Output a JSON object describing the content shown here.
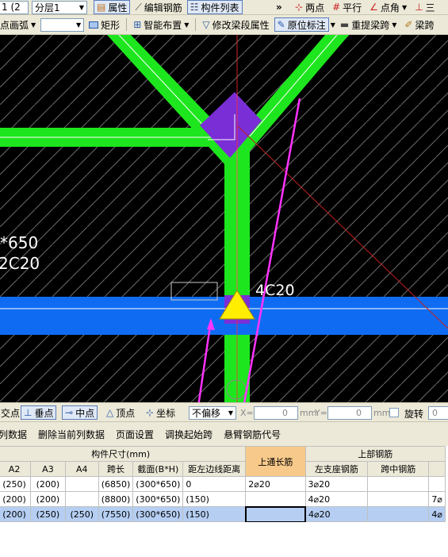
{
  "toolbar1": {
    "layer_select": "1 (2",
    "floor_select": "分层1",
    "btn_properties": "属性",
    "btn_edit_rebar": "编辑钢筋",
    "btn_component_list": "构件列表",
    "more": "»",
    "btn_two_points": "两点",
    "btn_parallel": "平行",
    "btn_point_angle": "点角",
    "btn_three": "三"
  },
  "toolbar2": {
    "btn_arc": "点画弧",
    "blank_select": "",
    "btn_rect": "矩形",
    "btn_smart_layout": "智能布置",
    "btn_modify_segment": "修改梁段属性",
    "btn_in_situ": "原位标注",
    "btn_repick_span": "重提梁跨",
    "btn_beam_span": "梁跨"
  },
  "canvas": {
    "label_section": "*650",
    "label_rebar_left": "2C20",
    "label_rebar": "4C20",
    "colors": {
      "beam_green": "#1ee61e",
      "beam_blue": "#0f6cf2",
      "column": "#7a2ed6",
      "support": "#ffee00",
      "arrow": "#ff33ff"
    }
  },
  "snapbar": {
    "btn_intersection": "交点",
    "btn_perpendicular": "垂点",
    "btn_midpoint": "中点",
    "btn_vertex": "顶点",
    "btn_coordinate": "坐标",
    "offset_select": "不偏移",
    "x_label": "X=",
    "x_value": "0",
    "y_label": "Y=",
    "y_value": "0",
    "unit_mm": "mm",
    "rotate_label": "旋转",
    "rotate_value": "0"
  },
  "actions": {
    "copy_column": "列数据",
    "delete_column": "删除当前列数据",
    "page_setup": "页面设置",
    "swap_start": "调换起始跨",
    "cantilever_code": "悬臂钢筋代号"
  },
  "table": {
    "group_size": "构件尺寸(mm)",
    "group_top_rebar": "上部钢筋",
    "headers": [
      "A2",
      "A3",
      "A4",
      "跨长",
      "截面(B*H)",
      "距左边线距离",
      "上通长筋",
      "左支座钢筋",
      "跨中钢筋",
      ""
    ],
    "rows": [
      [
        "(250)",
        "(200)",
        "",
        "(6850)",
        "(300*650)",
        "0",
        "2⌀20",
        "3⌀20",
        "",
        ""
      ],
      [
        "(200)",
        "(200)",
        "",
        "(8800)",
        "(300*650)",
        "(150)",
        "",
        "4⌀20",
        "",
        "7⌀"
      ],
      [
        "(200)",
        "(250)",
        "(250)",
        "(7550)",
        "(300*650)",
        "(150)",
        "",
        "4⌀20",
        "",
        "4⌀"
      ]
    ]
  }
}
